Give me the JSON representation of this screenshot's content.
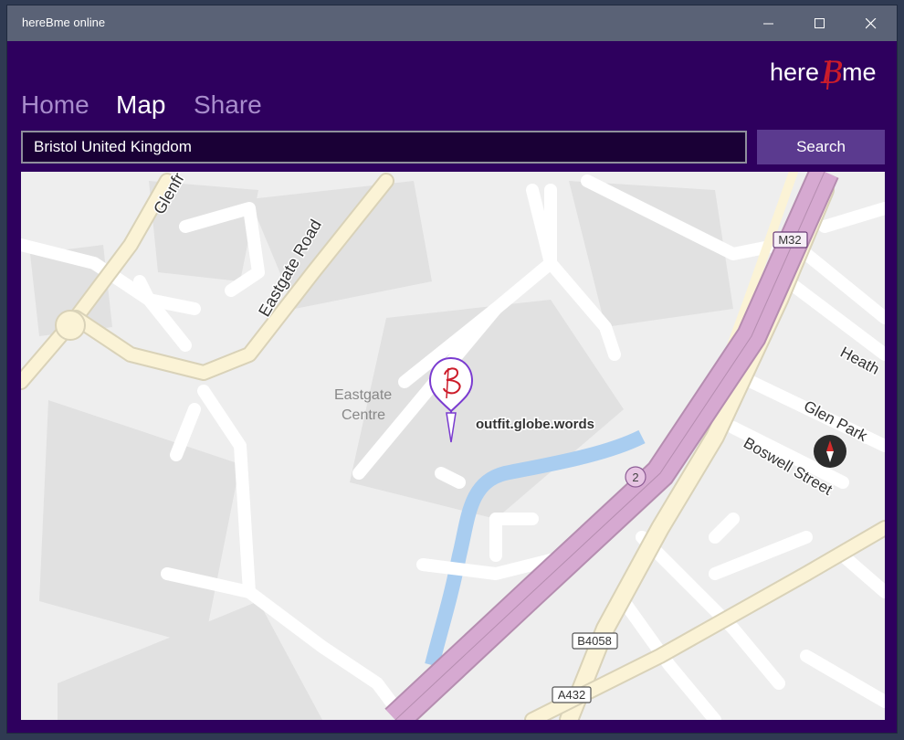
{
  "window": {
    "title": "hereBme online"
  },
  "logo": {
    "text_left": "here",
    "text_mid": "B",
    "text_right": "me"
  },
  "nav": {
    "items": [
      {
        "label": "Home",
        "active": false
      },
      {
        "label": "Map",
        "active": true
      },
      {
        "label": "Share",
        "active": false
      }
    ]
  },
  "search": {
    "value": "Bristol United Kingdom",
    "button_label": "Search"
  },
  "map": {
    "place_labels": {
      "eastgate_road": "Eastgate Road",
      "glenfrome": "Glenfr",
      "eastgate_centre_line1": "Eastgate",
      "eastgate_centre_line2": "Centre",
      "heath": "Heath",
      "glen_park": "Glen Park",
      "boswell_street": "Boswell Street"
    },
    "road_shields": {
      "m32": "M32",
      "b4058": "B4058",
      "a432": "A432",
      "junction": "2"
    },
    "pin_label": "outfit.globe.words"
  },
  "colors": {
    "app_background": "#2e005e",
    "accent": "#5b3a8f",
    "motorway": "#d6a9d1",
    "primary_road": "#fbf3d6",
    "water": "#a9cdf0"
  }
}
